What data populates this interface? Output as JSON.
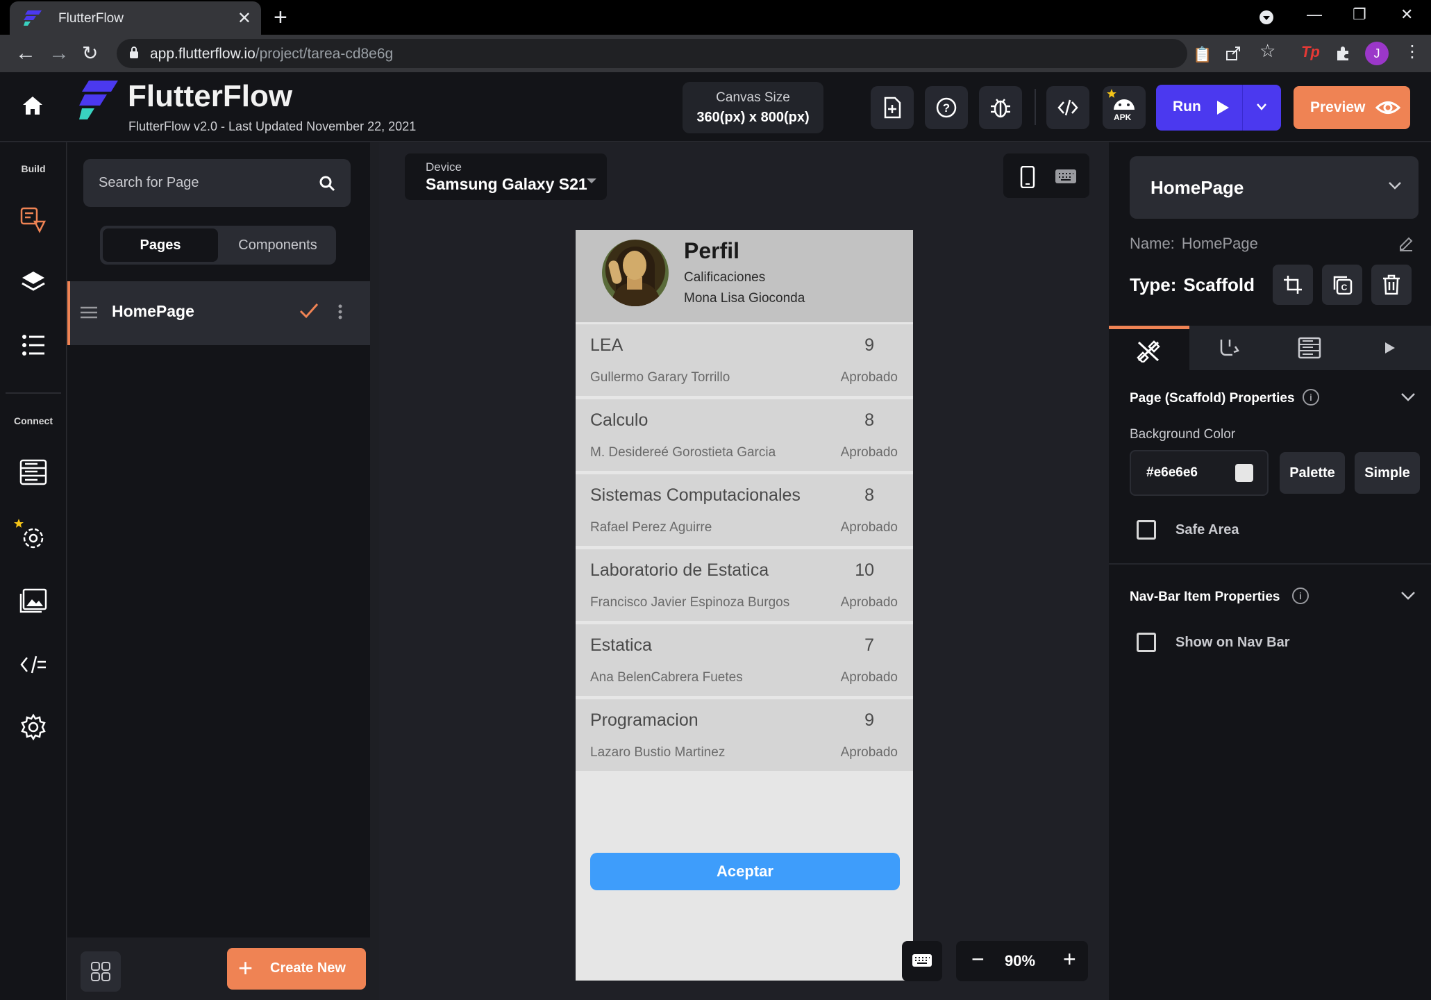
{
  "browser": {
    "tab_title": "FlutterFlow",
    "url_host": "app.flutterflow.io",
    "url_path": "/project/tarea-cd8e6g",
    "avatar_letter": "J",
    "ext_tp": "Tp"
  },
  "header": {
    "brand": "FlutterFlow",
    "subtitle": "FlutterFlow v2.0 - Last Updated November 22, 2021",
    "canvas_size_label": "Canvas Size",
    "canvas_size_value": "360(px) x 800(px)",
    "apk_label": "APK",
    "run_label": "Run",
    "preview_label": "Preview"
  },
  "rail": {
    "build_label": "Build",
    "connect_label": "Connect"
  },
  "pages_panel": {
    "search_placeholder": "Search for Page",
    "tab_pages": "Pages",
    "tab_components": "Components",
    "page_name": "HomePage",
    "create_new_label": "Create New"
  },
  "canvas": {
    "device_label": "Device",
    "device_value": "Samsung Galaxy S21",
    "zoom": "90%"
  },
  "phone": {
    "title": "Perfil",
    "subtitle": "Calificaciones",
    "student": "Mona Lisa Gioconda",
    "courses": [
      {
        "name": "LEA",
        "grade": "9",
        "professor": "Gullermo Garary Torrillo",
        "status": "Aprobado"
      },
      {
        "name": "Calculo",
        "grade": "8",
        "professor": "M. Desidereé Gorostieta Garcia",
        "status": "Aprobado"
      },
      {
        "name": "Sistemas Computacionales",
        "grade": "8",
        "professor": "Rafael Perez  Aguirre",
        "status": "Aprobado"
      },
      {
        "name": "Laboratorio de Estatica",
        "grade": "10",
        "professor": "Francisco Javier Espinoza Burgos",
        "status": "Aprobado"
      },
      {
        "name": "Estatica",
        "grade": "7",
        "professor": "Ana BelenCabrera Fuetes",
        "status": "Aprobado"
      },
      {
        "name": "Programacion",
        "grade": "9",
        "professor": "Lazaro Bustio Martinez",
        "status": "Aprobado"
      }
    ],
    "button_label": "Aceptar"
  },
  "properties": {
    "page_selected": "HomePage",
    "name_label": "Name:",
    "name_value": "HomePage",
    "type_label": "Type:",
    "type_value": "Scaffold",
    "section1_title": "Page (Scaffold) Properties",
    "bg_color_label": "Background Color",
    "bg_color_value": "#e6e6e6",
    "palette_label": "Palette",
    "simple_label": "Simple",
    "safe_area_label": "Safe Area",
    "section2_title": "Nav-Bar Item Properties",
    "show_nav_label": "Show on Nav Bar"
  },
  "colors": {
    "accent_orange": "#ef8354",
    "run_purple": "#4b39ef",
    "button_blue": "#3e9dfb",
    "page_bg": "#e6e6e6"
  }
}
